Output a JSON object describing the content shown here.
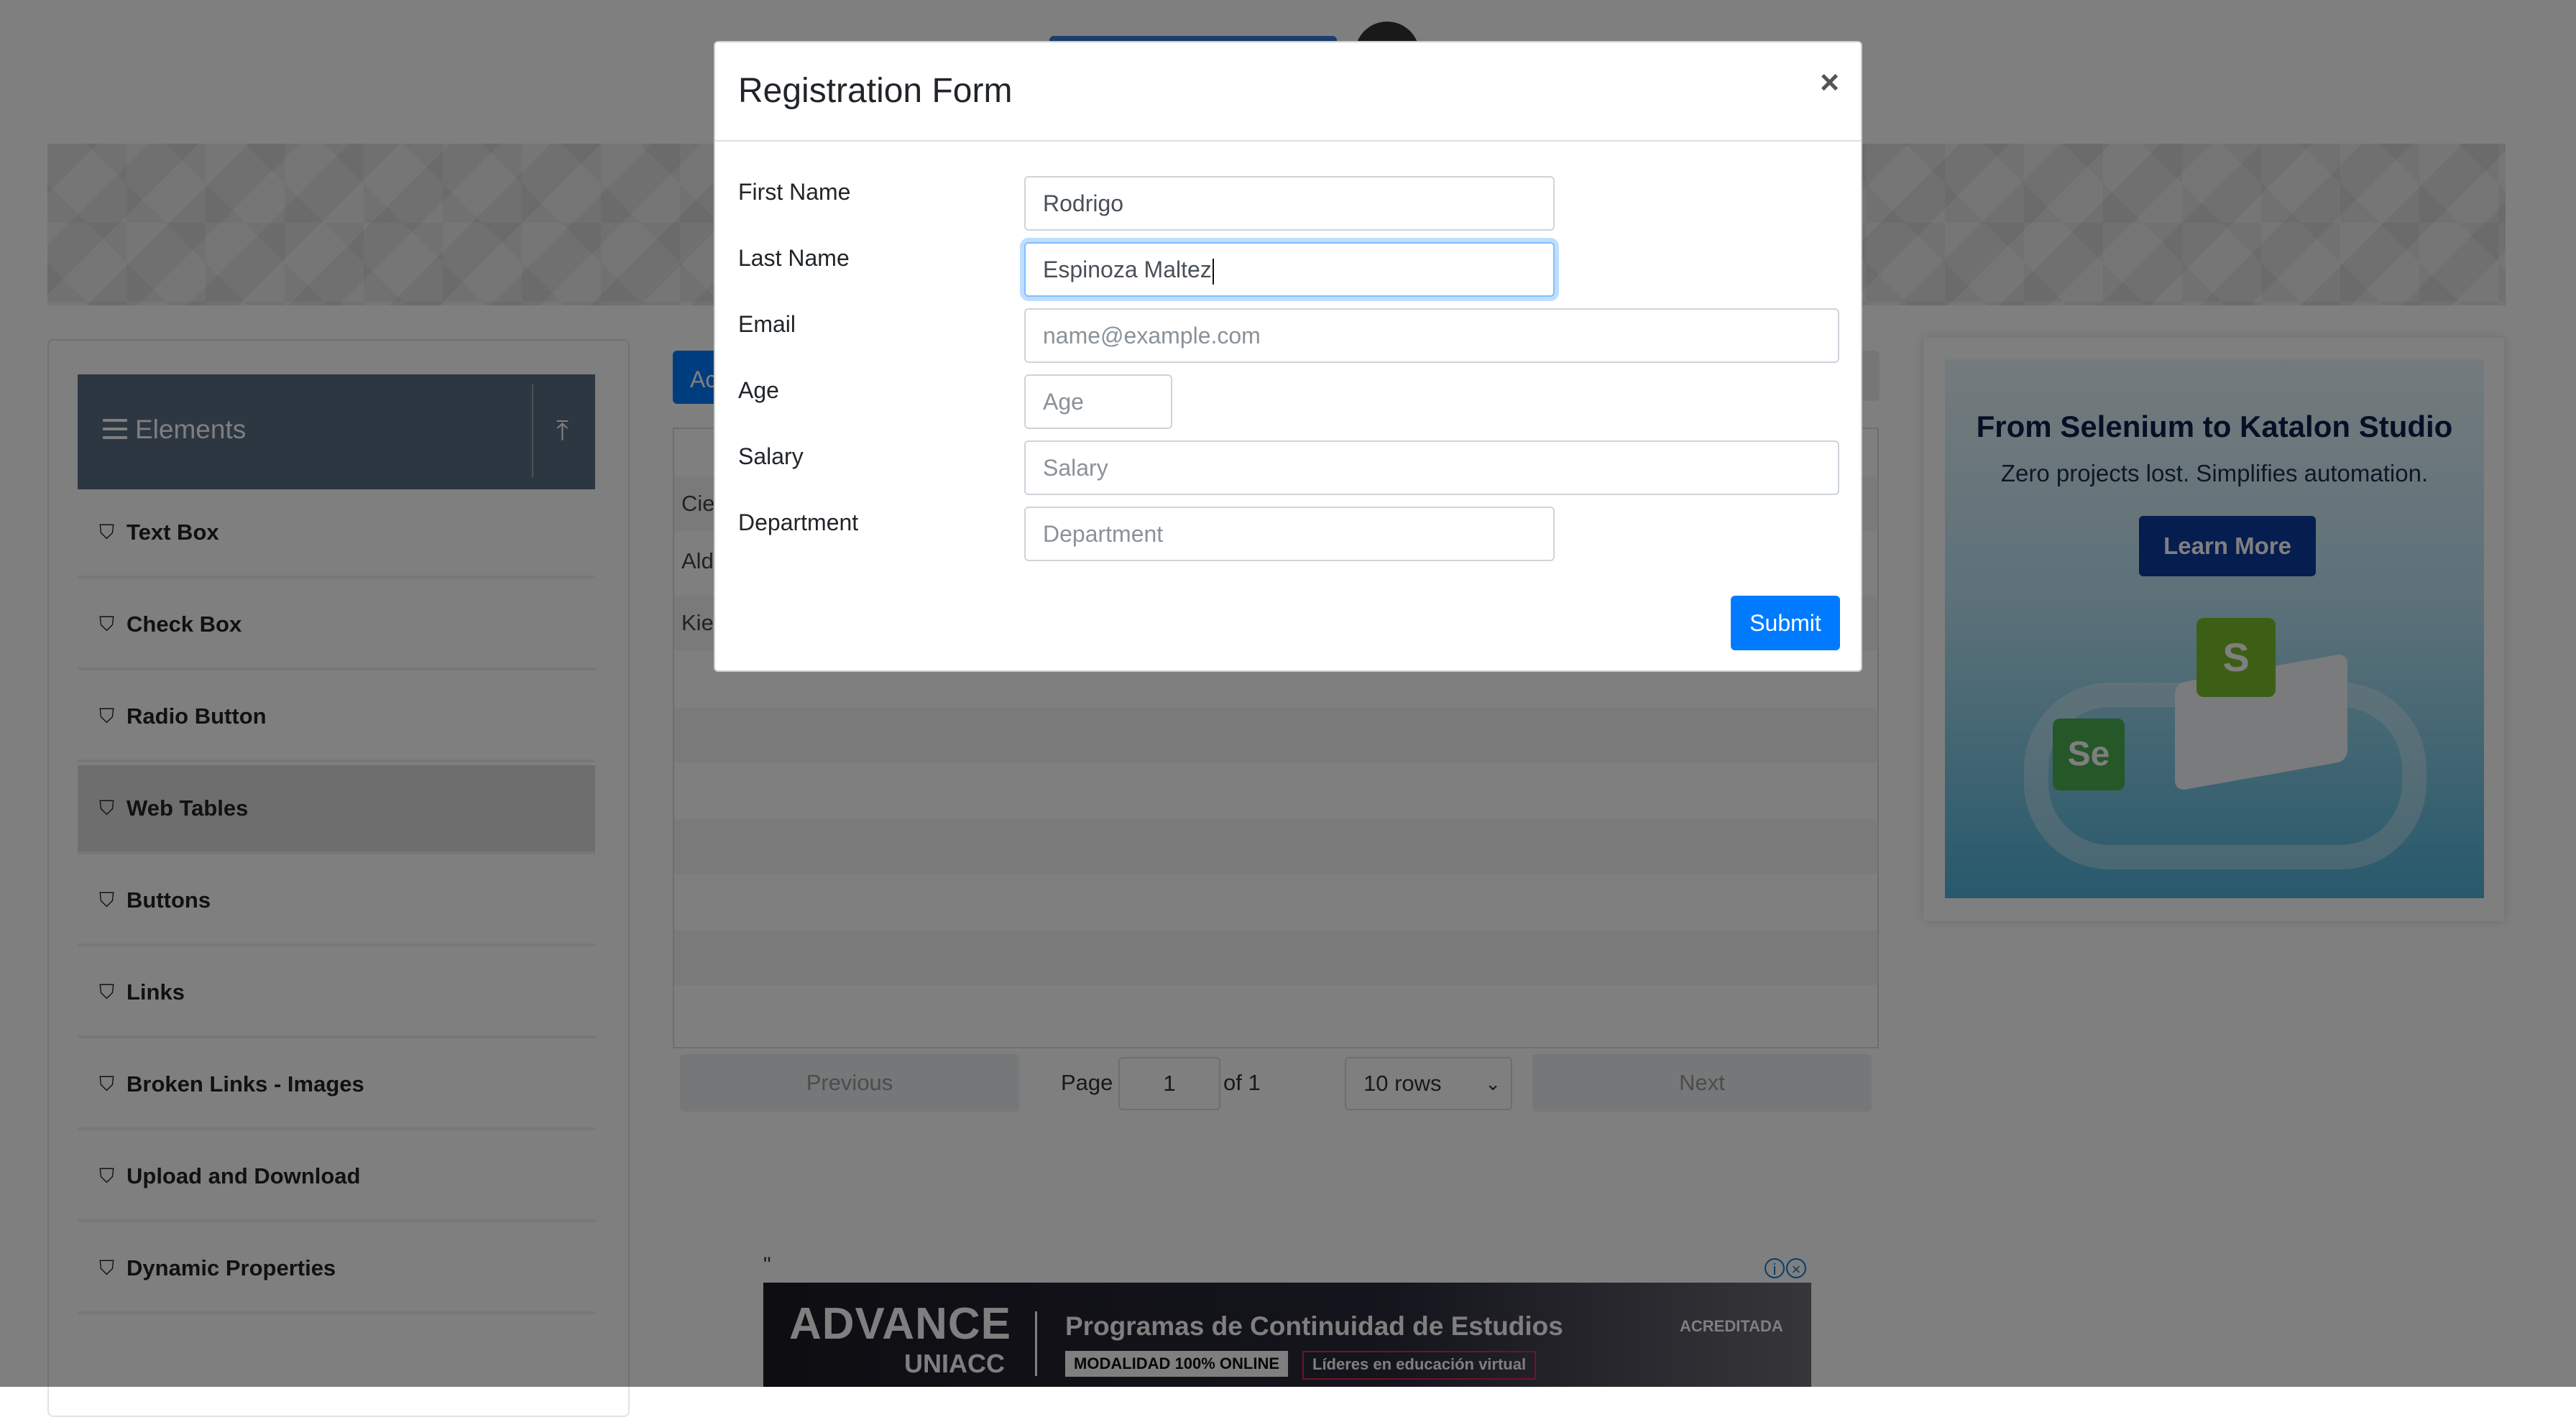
{
  "sidebar": {
    "group_title": "Elements",
    "items": [
      {
        "label": "Text Box"
      },
      {
        "label": "Check Box"
      },
      {
        "label": "Radio Button"
      },
      {
        "label": "Web Tables",
        "active": true
      },
      {
        "label": "Buttons"
      },
      {
        "label": "Links"
      },
      {
        "label": "Broken Links - Images"
      },
      {
        "label": "Upload and Download"
      },
      {
        "label": "Dynamic Properties"
      }
    ]
  },
  "main": {
    "add_label": "Ac",
    "rows": [
      "Cie",
      "Ald",
      "Kie"
    ],
    "pagination": {
      "previous": "Previous",
      "page_label": "Page",
      "page_value": "1",
      "of_label": "of 1",
      "rows_select": "10 rows",
      "next": "Next"
    }
  },
  "ad_right": {
    "title": "From Selenium to Katalon Studio",
    "subtitle": "Zero projects lost. Simplifies automation.",
    "button": "Learn More",
    "logo_s": "S",
    "logo_se": "Se"
  },
  "ad_bottom": {
    "quote": "\"",
    "brand": "ADVANCE",
    "sub_brand": "UNIACC",
    "headline": "Programas de Continuidad de Estudios",
    "tag1": "MODALIDAD 100% ONLINE",
    "tag2": "Líderes en educación virtual",
    "badge": "ACREDITADA"
  },
  "modal": {
    "title": "Registration Form",
    "close_symbol": "×",
    "fields": {
      "first_name": {
        "label": "First Name",
        "value": "Rodrigo"
      },
      "last_name": {
        "label": "Last Name",
        "value": "Espinoza Maltez"
      },
      "email": {
        "label": "Email",
        "placeholder": "name@example.com"
      },
      "age": {
        "label": "Age",
        "placeholder": "Age"
      },
      "salary": {
        "label": "Salary",
        "placeholder": "Salary"
      },
      "department": {
        "label": "Department",
        "placeholder": "Department"
      }
    },
    "submit": "Submit"
  },
  "colors": {
    "primary": "#007bff",
    "sidebar_header": "#5b6f84",
    "overlay": "rgba(0,0,0,0.5)"
  }
}
